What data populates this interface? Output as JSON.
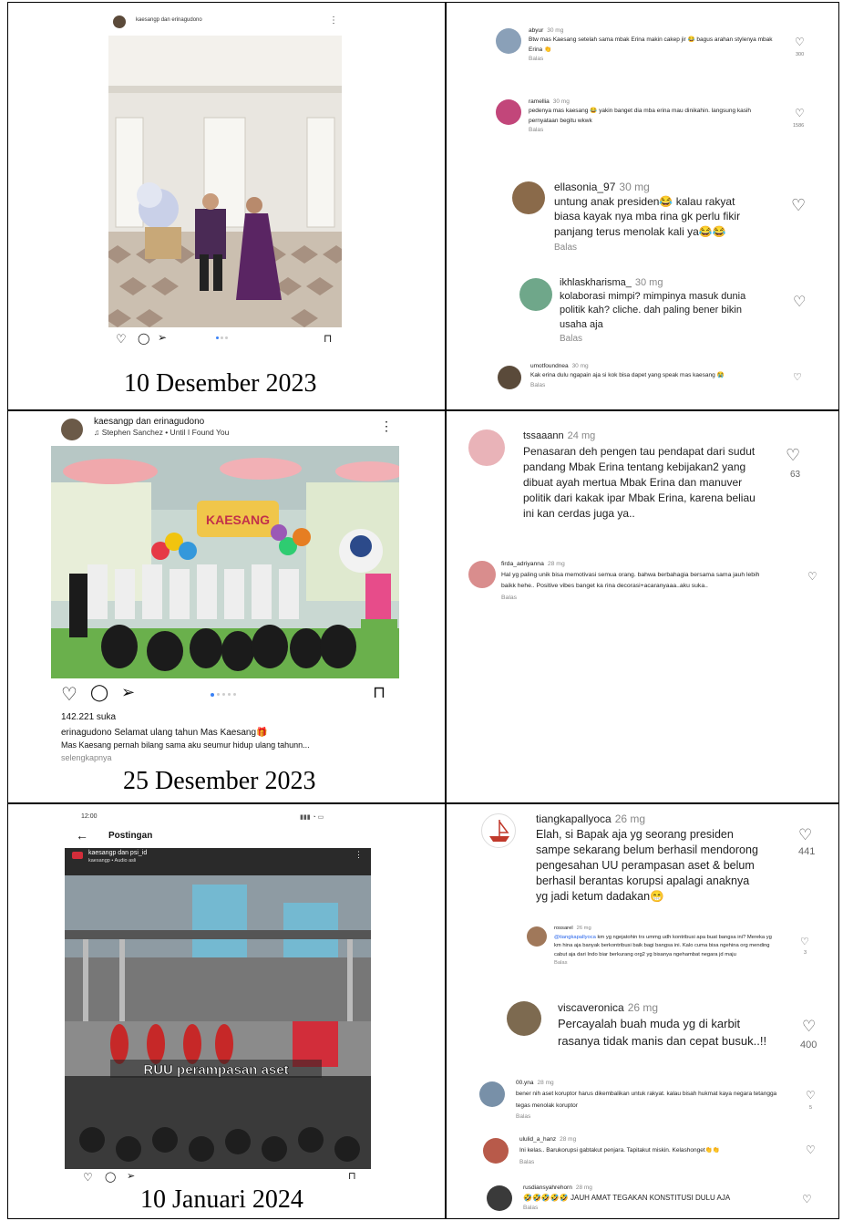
{
  "rows": [
    {
      "caption": "10 Desember 2023",
      "post": {
        "header": "kaesangp dan erinagudono"
      },
      "comments": [
        {
          "user": "abyur",
          "time": "30 mg",
          "text": "Btw mas Kaesang setelah sama mbak Erina makin cakep jir 😂 bagus arahan stylenya mbak Erina 👏",
          "likes": "300",
          "reply": "Balas"
        },
        {
          "user": "ramellia",
          "time": "30 mg",
          "text": "pedenya mas kaesang 😂 yakin banget dia mba erina mau dinikahin. langsung kasih pernyataan begitu wkwk",
          "likes": "1586",
          "reply": "Balas"
        },
        {
          "user": "ellasonia_97",
          "time": "30 mg",
          "text": "untung anak presiden😂 kalau rakyat biasa kayak nya mba rina gk perlu fikir panjang terus menolak kali ya😂😂",
          "likes": "",
          "reply": "Balas"
        },
        {
          "user": "ikhlaskharisma_",
          "time": "30 mg",
          "text": "kolaborasi mimpi? mimpinya masuk dunia politik kah? cliche. dah paling bener bikin usaha aja",
          "likes": "",
          "reply": "Balas"
        },
        {
          "user": "umotfoundnea",
          "time": "30 mg",
          "text": "Kak erina dulu ngapain aja si kok bisa dapet yang speak mas kaesang 😭",
          "likes": "",
          "reply": "Balas"
        }
      ]
    },
    {
      "caption": "25 Desember 2023",
      "post": {
        "header": "kaesangp dan erinagudono",
        "music": "Stephen Sanchez • Until I Found You",
        "likes": "142.221 suka",
        "caption_user": "erinagudono",
        "caption_text": "Selamat ulang tahun Mas Kaesang🎁",
        "caption_more": "Mas Kaesang pernah bilang sama aku seumur hidup ulang tahunn...",
        "more_link": "selengkapnya",
        "banner_text": "KAESANG"
      },
      "comments": [
        {
          "user": "tssaaann",
          "time": "24 mg",
          "text": "Penasaran deh pengen tau pendapat dari sudut pandang Mbak Erina tentang kebijakan2 yang dibuat ayah mertua Mbak Erina dan manuver politik dari kakak ipar Mbak Erina, karena beliau ini kan cerdas juga ya..",
          "likes": "63",
          "reply": ""
        },
        {
          "user": "firda_adriyanna",
          "time": "28 mg",
          "text": "Hal yg paling unik bisa memotivasi semua orang. bahwa berbahagia bersama sama jauh lebih baikk hehe.. Positive vibes banget ka rina decorasi+acaranyaaa..aku suka..",
          "likes": "",
          "reply": "Balas"
        }
      ]
    },
    {
      "caption": "10 Januari 2024",
      "post": {
        "status_time": "12:00",
        "nav_title": "Postingan",
        "header": "kaesangp dan psi_id",
        "audio": "kaesangp • Audio asli",
        "overlay": "RUU perampasan aset"
      },
      "comments": [
        {
          "user": "tiangkapallyoca",
          "time": "26 mg",
          "text": "Elah, si Bapak aja yg seorang presiden sampe sekarang belum berhasil mendorong pengesahan UU perampasan aset & belum berhasil berantas korupsi apalagi anaknya yg jadi ketum dadakan😁",
          "likes": "441",
          "reply": ""
        },
        {
          "user": "rossarel",
          "time": "26 mg",
          "mention": "@tiangkapallyoca",
          "text": "km yg ngejatohin trs ummg udh kontribusi apa buat bangsa ini? Mereka yg km hina aja banyak berkontribusi baik bagi bangsa ini. Kalo cuma bisa ngehina org mending cabut aja dari Indo biar berkurang org2 yg bisanya ngehambat negara jd maju",
          "likes": "3",
          "reply": "Balas"
        },
        {
          "user": "viscaveronica",
          "time": "26 mg",
          "text": "Percayalah buah muda yg di karbit rasanya tidak manis dan cepat busuk..!!",
          "likes": "400",
          "reply": ""
        },
        {
          "user": "00.yna",
          "time": "28 mg",
          "text": "bener nih aset koruptor harus dikembalikan untuk rakyat. kalau bisah hukmat kaya negara tetangga tegas menolak koruptor",
          "likes": "5",
          "reply": "Balas"
        },
        {
          "user": "ululid_a_hanz",
          "time": "28 mg",
          "text": "Ini kelas.. Barukorupsi gabtakut penjara. Tapitakut miskin. Kelashonget👏👏",
          "likes": "",
          "reply": "Balas"
        },
        {
          "user": "rusdiansyahrehorn",
          "time": "28 mg",
          "text": "🤣🤣🤣🤣🤣 JAUH AMAT TEGAKAN KONSTITUSI DULU AJA",
          "likes": "",
          "reply": "Balas"
        }
      ]
    }
  ],
  "icons": [
    "heart-icon",
    "comment-icon",
    "share-icon",
    "bookmark-icon",
    "more-icon",
    "back-arrow-icon"
  ]
}
